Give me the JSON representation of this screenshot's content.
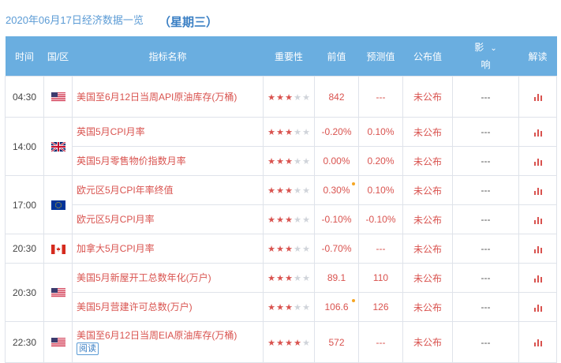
{
  "header": {
    "date_title": "2020年06月17日经济数据一览",
    "weekday": "（星期三）"
  },
  "columns": {
    "time": "时间",
    "country": "国/区",
    "indicator": "指标名称",
    "importance": "重要性",
    "previous": "前值",
    "forecast": "预测值",
    "actual": "公布值",
    "impact_top": "影",
    "impact_bottom": "响",
    "interpret": "解读"
  },
  "groups": [
    {
      "time": "04:30",
      "rows": [
        {
          "flag": "us-flag-icon",
          "name": "美国至6月12日当周API原油库存(万桶)",
          "stars": 3,
          "previous": "842",
          "forecast": "---",
          "actual": "未公布",
          "impact": "---"
        }
      ]
    },
    {
      "time": "14:00",
      "rows": [
        {
          "flag": "uk-flag-icon",
          "name": "英国5月CPI月率",
          "stars": 3,
          "previous": "-0.20%",
          "forecast": "0.10%",
          "actual": "未公布",
          "impact": "---"
        },
        {
          "flag": "",
          "name": "英国5月零售物价指数月率",
          "stars": 3,
          "previous": "0.00%",
          "forecast": "0.20%",
          "actual": "未公布",
          "impact": "---"
        }
      ]
    },
    {
      "time": "17:00",
      "rows": [
        {
          "flag": "eu-flag-icon",
          "name": "欧元区5月CPI年率终值",
          "stars": 3,
          "previous": "0.30%",
          "forecast": "0.10%",
          "actual": "未公布",
          "impact": "---",
          "revised": true
        },
        {
          "flag": "",
          "name": "欧元区5月CPI月率",
          "stars": 3,
          "previous": "-0.10%",
          "forecast": "-0.10%",
          "actual": "未公布",
          "impact": "---"
        }
      ]
    },
    {
      "time": "20:30",
      "rows": [
        {
          "flag": "canada-flag-icon",
          "name": "加拿大5月CPI月率",
          "stars": 3,
          "previous": "-0.70%",
          "forecast": "---",
          "actual": "未公布",
          "impact": "---"
        }
      ]
    },
    {
      "time": "20:30",
      "rows": [
        {
          "flag": "us-flag-icon",
          "name": "美国5月新屋开工总数年化(万户)",
          "stars": 3,
          "previous": "89.1",
          "forecast": "110",
          "actual": "未公布",
          "impact": "---"
        },
        {
          "flag": "",
          "name": "美国5月营建许可总数(万户)",
          "stars": 3,
          "previous": "106.6",
          "forecast": "126",
          "actual": "未公布",
          "impact": "---",
          "revised": true
        }
      ]
    },
    {
      "time": "22:30",
      "rows": [
        {
          "flag": "us-flag-icon",
          "name": "美国至6月12日当周EIA原油库存(万桶)",
          "read_label": "阅读",
          "stars": 4,
          "previous": "572",
          "forecast": "---",
          "actual": "未公布",
          "impact": "---"
        }
      ]
    }
  ],
  "colors": {
    "header_bg": "#6aaee0",
    "accent_red": "#d9534f",
    "revised_dot": "#f5a623",
    "title_blue": "#5b9bd5"
  }
}
